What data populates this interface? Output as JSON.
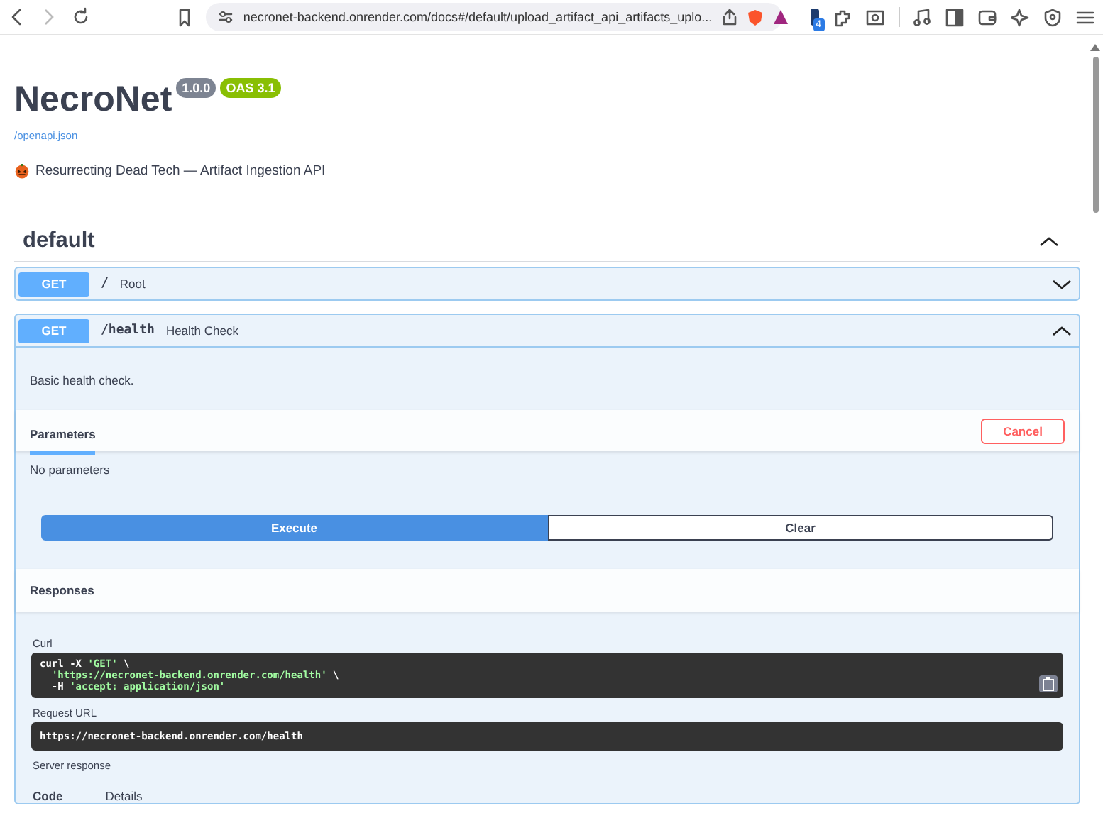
{
  "browser": {
    "url": "necronet-backend.onrender.com/docs#/default/upload_artifact_api_artifacts_uplo...",
    "tab_count": "4"
  },
  "info": {
    "title": "NecroNet",
    "version": "1.0.0",
    "oas": "OAS 3.1",
    "spec_link": "/openapi.json",
    "description": "Resurrecting Dead Tech — Artifact Ingestion API"
  },
  "section": {
    "name": "default",
    "expanded": true
  },
  "operations": [
    {
      "method": "GET",
      "path": "/",
      "summary": "Root",
      "expanded": false
    },
    {
      "method": "GET",
      "path": "/health",
      "summary": "Health Check",
      "expanded": true,
      "description": "Basic health check.",
      "parameters_tab": "Parameters",
      "cancel": "Cancel",
      "no_parameters": "No parameters",
      "execute": "Execute",
      "clear": "Clear",
      "responses_title": "Responses",
      "curl_label": "Curl",
      "curl_lines": [
        "curl -X 'GET' \\",
        "  'https://necronet-backend.onrender.com/health' \\",
        "  -H 'accept: application/json'"
      ],
      "request_url_label": "Request URL",
      "request_url": "https://necronet-backend.onrender.com/health",
      "server_response_label": "Server response",
      "columns": [
        "Code",
        "Details"
      ]
    }
  ]
}
